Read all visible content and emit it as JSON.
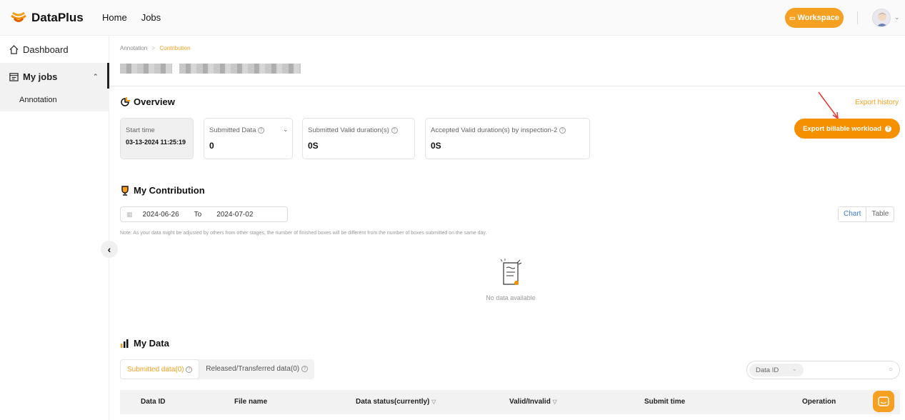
{
  "topbar": {
    "brand": "DataPlus",
    "nav": [
      "Home",
      "Jobs"
    ],
    "workspace_label": "Workspace",
    "colors": {
      "accent": "#f5a020"
    }
  },
  "sidebar": {
    "items": [
      {
        "label": "Dashboard",
        "icon": "home-icon"
      },
      {
        "label": "My jobs",
        "icon": "calendar-icon"
      },
      {
        "label": "Annotation"
      }
    ]
  },
  "breadcrumb": {
    "parent": "Annotation",
    "separator": ">",
    "current": "Contribution"
  },
  "overview": {
    "title": "Overview",
    "export_history": "Export history",
    "export_button": "Export billable workload",
    "cards": [
      {
        "label": "Start time",
        "value": "03-13-2024 11:25:19"
      },
      {
        "label": "Submitted Data",
        "value": "0"
      },
      {
        "label": "Submitted Valid duration(s)",
        "value": "0S"
      },
      {
        "label": "Accepted Valid duration(s) by inspection-2",
        "value": "0S"
      }
    ]
  },
  "contribution": {
    "title": "My Contribution",
    "date_from": "2024-06-26",
    "date_to_word": "To",
    "date_to": "2024-07-02",
    "view_chart": "Chart",
    "view_table": "Table",
    "note": "Note: As your data might be adjusted by others from other stages, the number of finished boxes will be different from the number of boxes submitted on the same day.",
    "empty_text": "No data available"
  },
  "mydata": {
    "title": "My Data",
    "tabs": [
      "Submitted data(0)",
      "Released/Transferred data(0)"
    ],
    "search_field": "Data ID",
    "columns": [
      "Data ID",
      "File name",
      "Data status(currently)",
      "Valid/Invalid",
      "Submit time",
      "Operation"
    ]
  }
}
